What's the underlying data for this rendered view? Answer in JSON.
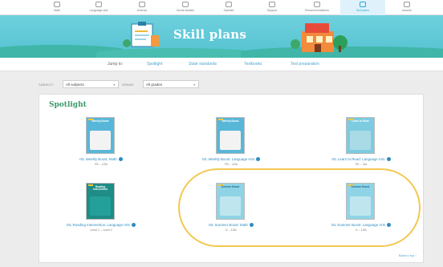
{
  "nav": {
    "items": [
      {
        "label": "Math",
        "icon": "math-icon"
      },
      {
        "label": "Language arts",
        "icon": "book-icon"
      },
      {
        "label": "Science",
        "icon": "flask-icon"
      },
      {
        "label": "Social studies",
        "icon": "globe-icon"
      },
      {
        "label": "Spanish",
        "icon": "speech-icon"
      },
      {
        "label": "Support",
        "icon": "support-icon"
      },
      {
        "label": "Recommendations",
        "icon": "star-icon"
      },
      {
        "label": "Skill plans",
        "icon": "plan-icon",
        "active": true
      },
      {
        "label": "Awards",
        "icon": "trophy-icon"
      }
    ]
  },
  "banner": {
    "title": "Skill plans"
  },
  "subnav": {
    "jump_to": "Jump to:",
    "links": [
      "Spotlight",
      "State standards",
      "Textbooks",
      "Test preparation"
    ]
  },
  "filters": {
    "subject_label": "SUBJECT:",
    "subject_value": "All subjects",
    "grade_label": "GRADE:",
    "grade_value": "All grades"
  },
  "spotlight": {
    "title": "Spotlight",
    "books": [
      {
        "cover_title": "Weekly Boost",
        "title": "IXL Weekly Boost: Math",
        "grade": "PK – 12th",
        "color": "#58b7d8",
        "body": "#f3f3f3"
      },
      {
        "cover_title": "Weekly Boost",
        "title": "IXL Weekly Boost: Language Arts",
        "grade": "PK – 12th",
        "color": "#58b7d8",
        "body": "#f3f3f3"
      },
      {
        "cover_title": "Learn to Read",
        "title": "IXL Learn to Read: Language Arts",
        "grade": "PK – 3rd",
        "color": "#7ccbe0",
        "body": "#a9dbe6"
      },
      {
        "cover_title": "Reading Intervention",
        "title": "IXL Reading Intervention: Language Arts",
        "grade": "Level 1 – Level 2",
        "color": "#1f8c86",
        "body": "#23a099"
      },
      {
        "cover_title": "Summer Boost",
        "title": "IXL Summer Boost: Math",
        "grade": "K – 12th",
        "color": "#8fd4e6",
        "body": "#bfe6ef"
      },
      {
        "cover_title": "Summer Boost",
        "title": "IXL Summer Boost: Language Arts",
        "grade": "K – 12th",
        "color": "#8fd4e6",
        "body": "#bfe6ef"
      }
    ],
    "back_to_top": "Back to top ↑"
  }
}
